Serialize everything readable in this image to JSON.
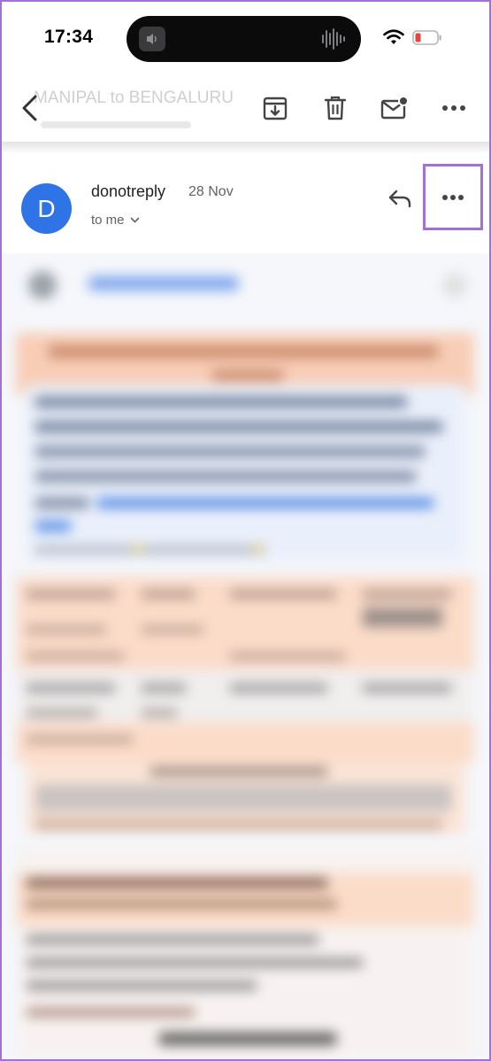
{
  "status_bar": {
    "time": "17:34",
    "icons": [
      "speaker-icon",
      "waveform-icon",
      "wifi-icon",
      "battery-low-icon"
    ],
    "battery_color": "#e64545"
  },
  "header": {
    "subject": "MANIPAL to BENGALURU",
    "actions": [
      "back-icon",
      "archive-icon",
      "trash-icon",
      "mark-unread-icon",
      "more-horizontal-icon"
    ]
  },
  "message": {
    "avatar_letter": "D",
    "avatar_color": "#2f74e6",
    "sender": "donotreply",
    "date": "28 Nov",
    "recipient": "to me",
    "actions": [
      "reply-icon",
      "more-horizontal-icon"
    ],
    "highlight_color": "#a56fd6"
  }
}
